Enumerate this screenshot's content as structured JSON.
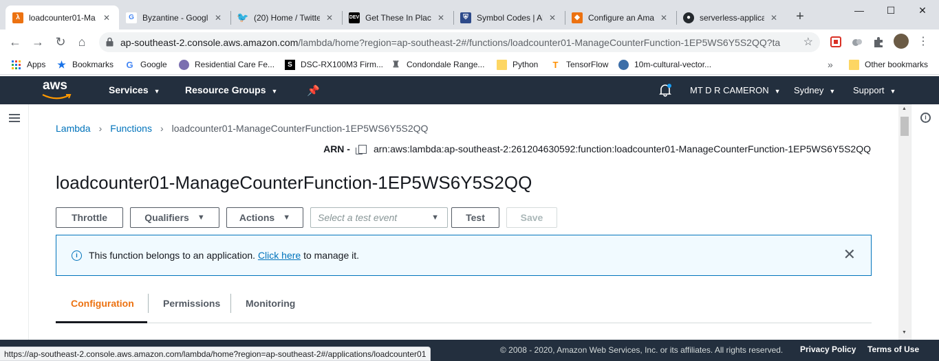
{
  "browser": {
    "tabs": [
      {
        "title": "loadcounter01-Ma",
        "icon": "aws-lambda-icon",
        "color": "#ec7211"
      },
      {
        "title": "Byzantine - Googl",
        "icon": "google-icon",
        "color": "#4285f4"
      },
      {
        "title": "(20) Home / Twitte",
        "icon": "twitter-icon",
        "color": "#1da1f2"
      },
      {
        "title": "Get These In Place",
        "icon": "dev-icon",
        "color": "#000000"
      },
      {
        "title": "Symbol Codes | Al",
        "icon": "shield-icon",
        "color": "#2d4a8a"
      },
      {
        "title": "Configure an Ama",
        "icon": "aws-box-icon",
        "color": "#ec7211"
      },
      {
        "title": "serverless-applicat",
        "icon": "github-icon",
        "color": "#24292e"
      }
    ],
    "url_host": "ap-southeast-2.console.aws.amazon.com",
    "url_path": "/lambda/home?region=ap-southeast-2#/functions/loadcounter01-ManageCounterFunction-1EP5WS6Y5S2QQ?tab...",
    "bookmarks": [
      {
        "label": "Apps",
        "icon": "apps-grid-icon"
      },
      {
        "label": "Bookmarks",
        "icon": "star-icon"
      },
      {
        "label": "Google",
        "icon": "google-icon"
      },
      {
        "label": "Residential Care Fe...",
        "icon": "globe-icon"
      },
      {
        "label": "DSC-RX100M3 Firm...",
        "icon": "s-icon"
      },
      {
        "label": "Condondale Range...",
        "icon": "crest-icon"
      },
      {
        "label": "Python",
        "icon": "folder-icon"
      },
      {
        "label": "TensorFlow",
        "icon": "tensorflow-icon"
      },
      {
        "label": "10m-cultural-vector...",
        "icon": "globe-icon"
      }
    ],
    "other_bookmarks": "Other bookmarks",
    "more_bookmarks": "»",
    "status_url": "https://ap-southeast-2.console.aws.amazon.com/lambda/home?region=ap-southeast-2#/applications/loadcounter01"
  },
  "aws_nav": {
    "logo": "aws",
    "services": "Services",
    "resource_groups": "Resource Groups",
    "account": "MT D R CAMERON",
    "region": "Sydney",
    "support": "Support"
  },
  "breadcrumb": {
    "root": "Lambda",
    "section": "Functions",
    "current": "loadcounter01-ManageCounterFunction-1EP5WS6Y5S2QQ"
  },
  "arn": {
    "label": "ARN -",
    "value": "arn:aws:lambda:ap-southeast-2:261204630592:function:loadcounter01-ManageCounterFunction-1EP5WS6Y5S2QQ"
  },
  "page_title": "loadcounter01-ManageCounterFunction-1EP5WS6Y5S2QQ",
  "actions": {
    "throttle": "Throttle",
    "qualifiers": "Qualifiers",
    "actions": "Actions",
    "test_event_placeholder": "Select a test event",
    "test": "Test",
    "save": "Save"
  },
  "alert": {
    "text_before": "This function belongs to an application.",
    "link": "Click here",
    "text_after": "to manage it."
  },
  "tabs": [
    "Configuration",
    "Permissions",
    "Monitoring"
  ],
  "footer": {
    "copyright": "© 2008 - 2020, Amazon Web Services, Inc. or its affiliates. All rights reserved.",
    "privacy": "Privacy Policy",
    "terms": "Terms of Use"
  },
  "colors": {
    "aws_nav": "#232f3e",
    "aws_orange": "#ec7211",
    "link_blue": "#0073bb"
  }
}
